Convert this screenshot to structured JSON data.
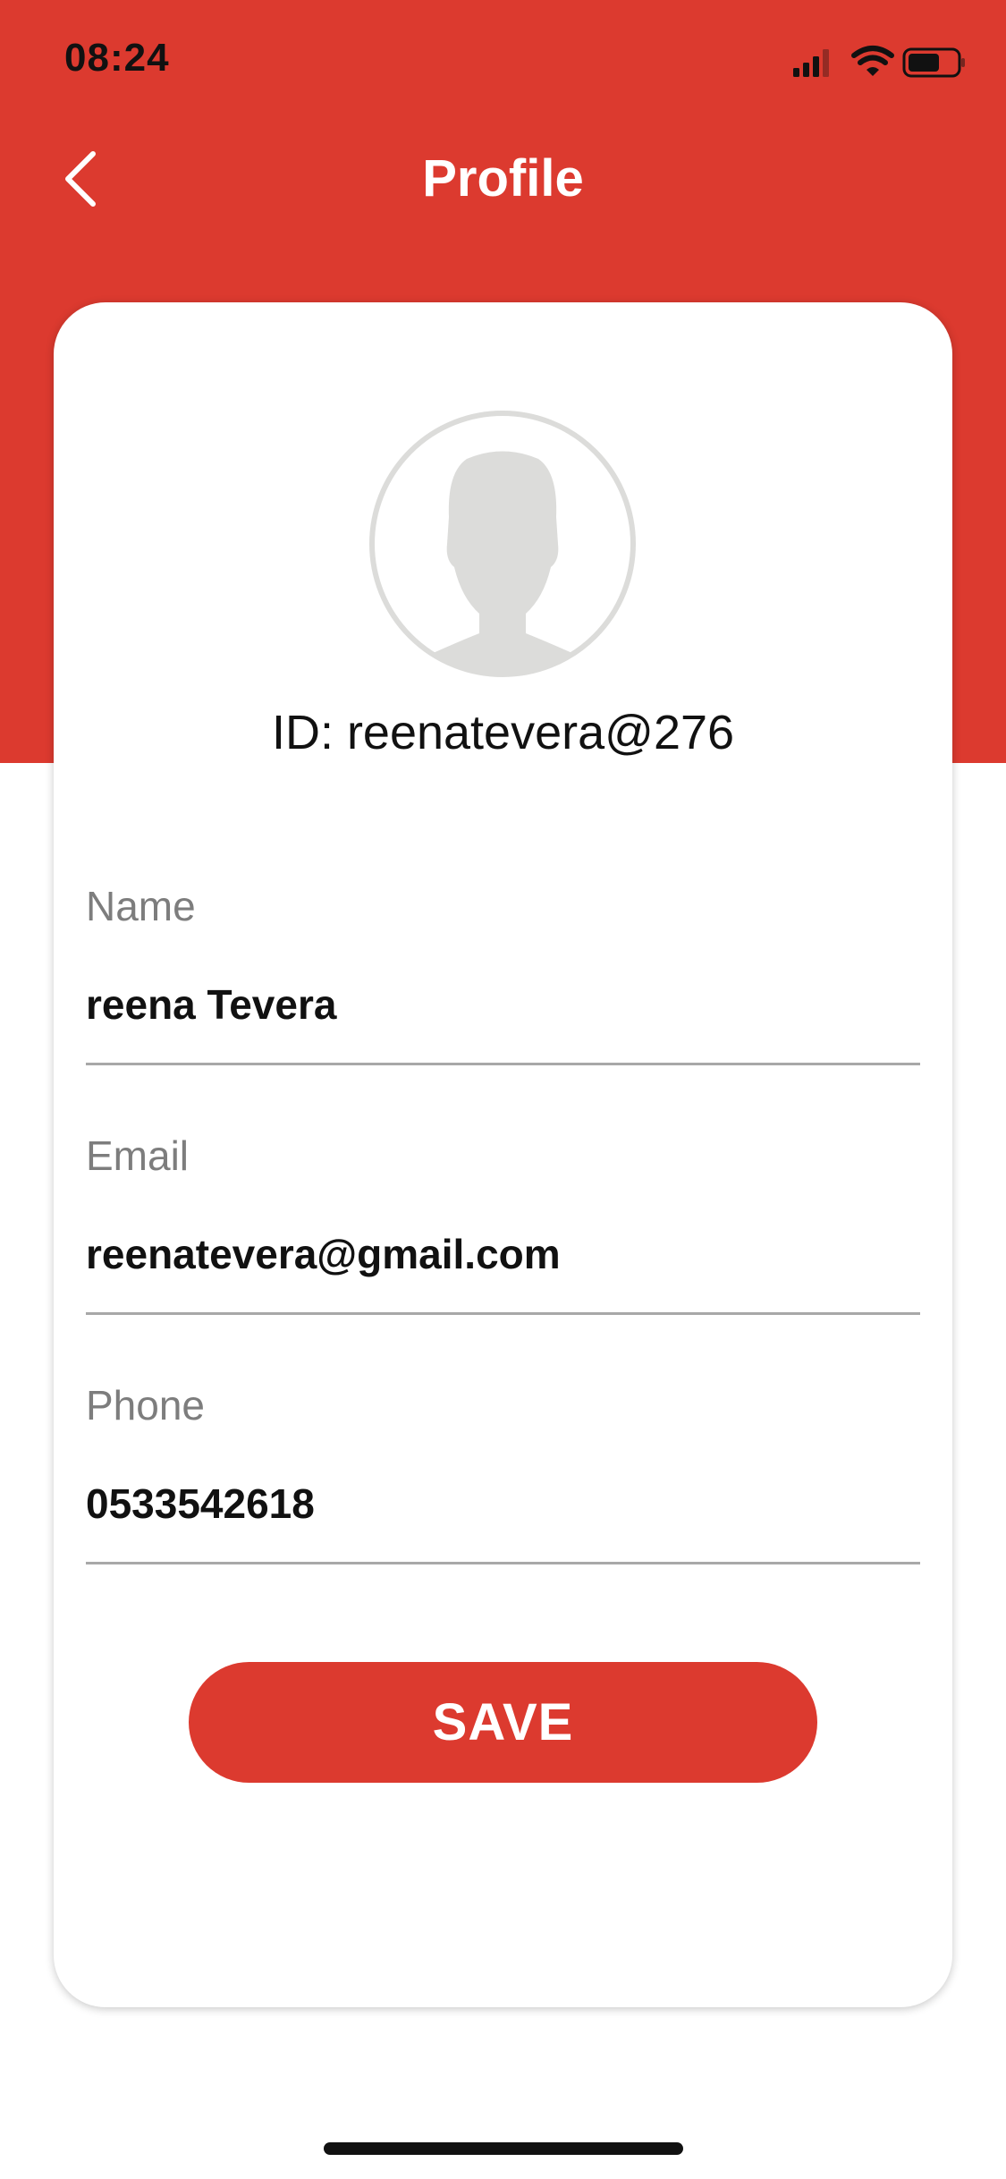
{
  "status_bar": {
    "time": "08:24",
    "icons": [
      "signal-icon",
      "wifi-icon",
      "battery-icon"
    ]
  },
  "header": {
    "title": "Profile",
    "back_icon": "chevron-left-icon"
  },
  "profile": {
    "avatar_icon": "user-avatar-icon",
    "id_text": "ID: reenatevera@276"
  },
  "fields": {
    "name": {
      "label": "Name",
      "value": "reena Tevera"
    },
    "email": {
      "label": "Email",
      "value": "reenatevera@gmail.com"
    },
    "phone": {
      "label": "Phone",
      "value": "0533542618"
    }
  },
  "actions": {
    "save_label": "SAVE"
  },
  "colors": {
    "brand_red": "#DC3A2F",
    "label_gray": "#7d7d7d",
    "avatar_gray": "#dcdcda"
  }
}
